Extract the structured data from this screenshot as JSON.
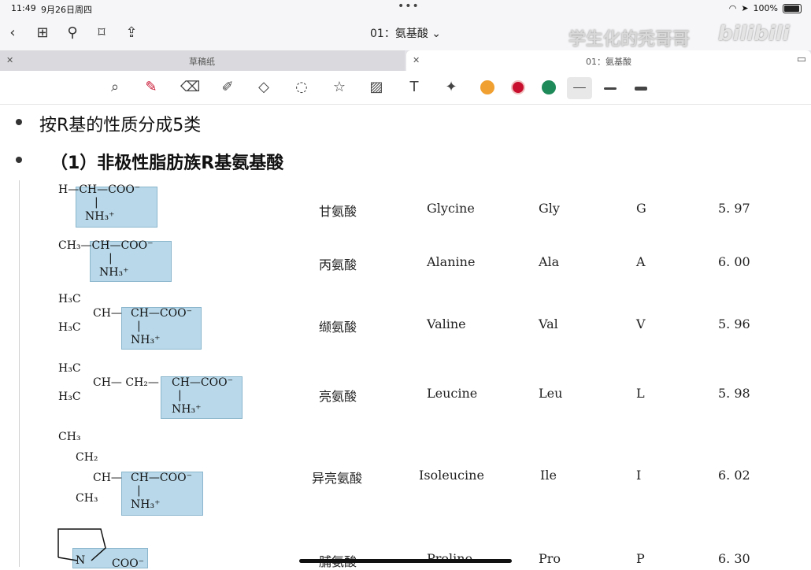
{
  "status": {
    "time": "11:49",
    "date": "9月26日周四",
    "battery": "100%"
  },
  "nav": {
    "title": "01：氨基酸",
    "watermark": "学生化的秃哥哥",
    "watermark2": "bilibili"
  },
  "tabs": [
    {
      "label": "草稿纸"
    },
    {
      "label": "01：氨基酸"
    }
  ],
  "content": {
    "heading1": "按R基的性质分成5类",
    "heading2": "（1）非极性脂肪族R基氨基酸",
    "rows": [
      {
        "cn": "甘氨酸",
        "en": "Glycine",
        "abbr": "Gly",
        "code": "G",
        "pi": "5. 97"
      },
      {
        "cn": "丙氨酸",
        "en": "Alanine",
        "abbr": "Ala",
        "code": "A",
        "pi": "6. 00"
      },
      {
        "cn": "缬氨酸",
        "en": "Valine",
        "abbr": "Val",
        "code": "V",
        "pi": "5. 96"
      },
      {
        "cn": "亮氨酸",
        "en": "Leucine",
        "abbr": "Leu",
        "code": "L",
        "pi": "5. 98"
      },
      {
        "cn": "异亮氨酸",
        "en": "Isoleucine",
        "abbr": "Ile",
        "code": "I",
        "pi": "6. 02"
      },
      {
        "cn": "脯氨酸",
        "en": "Proline",
        "abbr": "Pro",
        "code": "P",
        "pi": "6. 30"
      }
    ],
    "formulas": {
      "gly_top": "H—CH—COO⁻",
      "ala_top": "CH₃—CH—COO⁻",
      "nh3": "NH₃⁺",
      "val_a": "H₃C",
      "val_b": "CH—",
      "val_c": "CH—COO⁻",
      "val_d": "H₃C",
      "leu_a": "H₃C",
      "leu_b": "CH— CH₂—",
      "leu_c": "CH—COO⁻",
      "leu_d": "H₃C",
      "ile_a": "CH₃",
      "ile_b": "CH₂",
      "ile_c": "CH—",
      "ile_d": "CH—COO⁻",
      "ile_e": "CH₃",
      "pro_n": "N",
      "pro_c": "COO⁻"
    }
  },
  "colors": {
    "orange": "#f0a030",
    "red": "#c8102e",
    "green": "#1e8a5a",
    "highlight": "#b9d9ea"
  }
}
